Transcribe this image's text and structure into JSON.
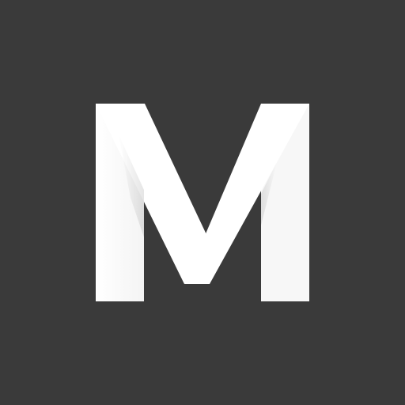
{
  "app_icon": {
    "icon_name": "letter-m-logo-icon",
    "logo_letter": "M",
    "colors": {
      "background": "#3a3a3a",
      "letter": "#ffffff",
      "letter_shade": "#f7f7f7",
      "fold_shadow": "#d6d6d6"
    }
  }
}
